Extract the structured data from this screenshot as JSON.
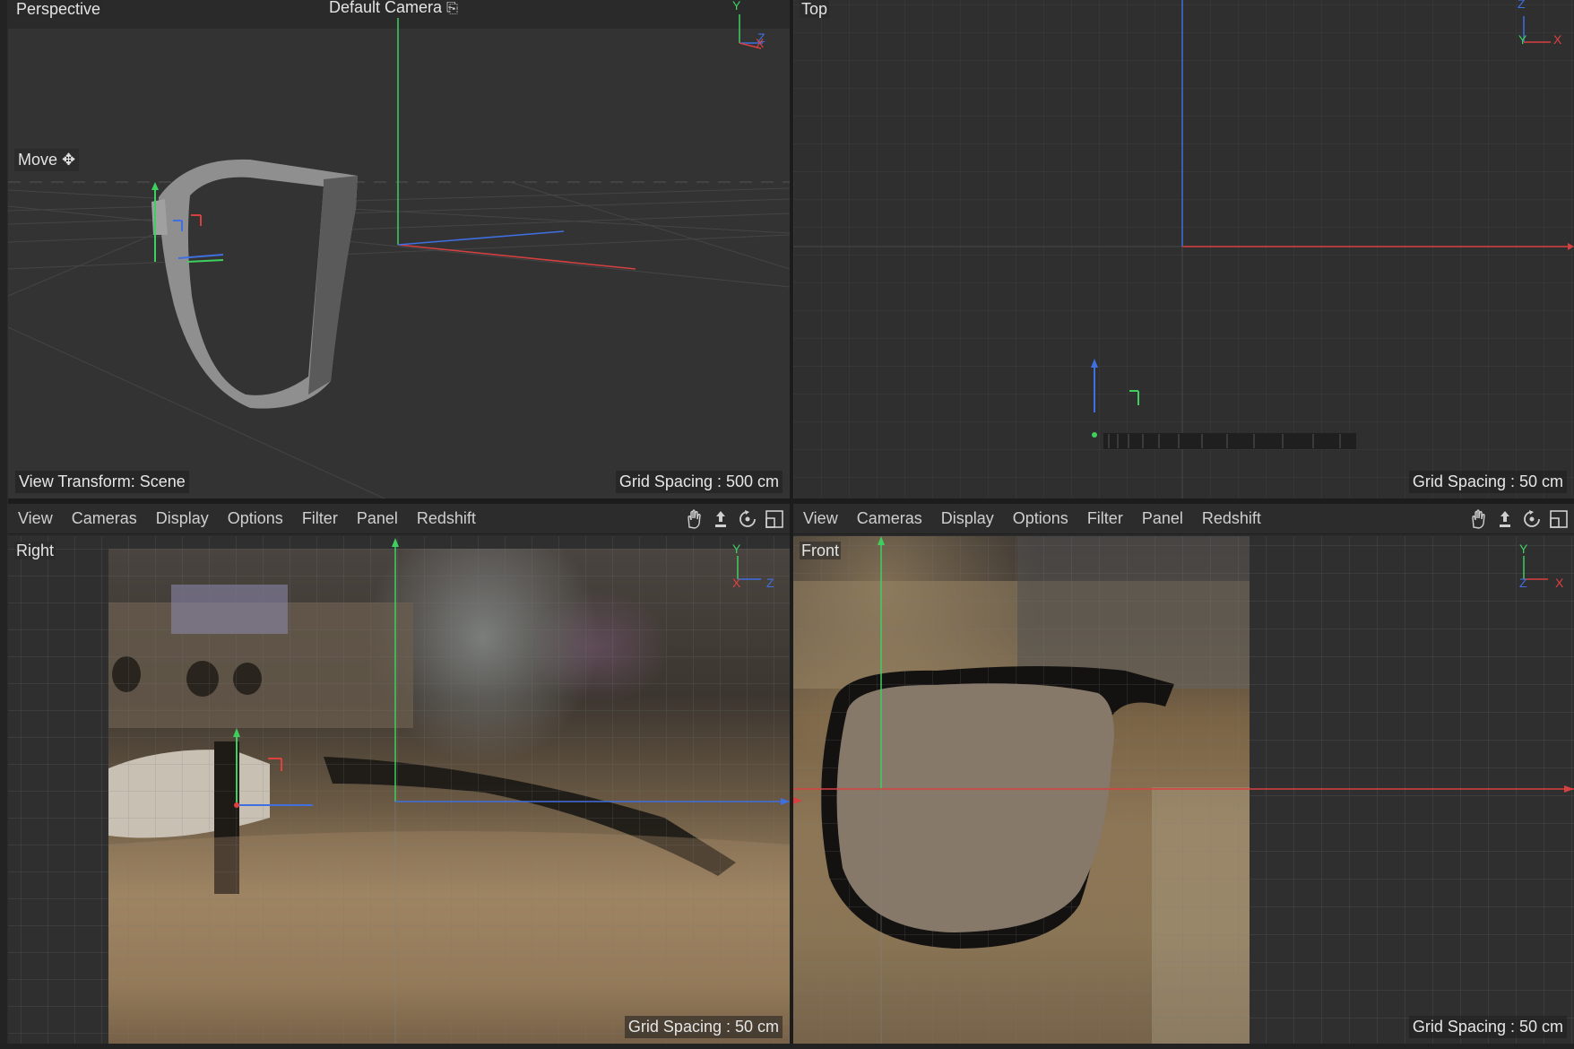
{
  "colors": {
    "x_axis": "#e04040",
    "y_axis": "#40d060",
    "z_axis": "#3f6fe0",
    "grid_line": "#3d3d3e",
    "viewport_bg": "#2f2f30"
  },
  "perspective": {
    "label": "Perspective",
    "camera": "Default Camera",
    "tool": "Move",
    "view_transform": "View Transform: Scene",
    "grid_spacing": "Grid Spacing : 500 cm",
    "axis_labels": {
      "y": "Y",
      "z": "Z",
      "x": "X"
    }
  },
  "top": {
    "label": "Top",
    "grid_spacing": "Grid Spacing : 50 cm",
    "axis_labels": {
      "z": "Z",
      "x": "X",
      "y": "Y"
    }
  },
  "right": {
    "label": "Right",
    "grid_spacing": "Grid Spacing : 50 cm",
    "axis_labels": {
      "y": "Y",
      "x": "X",
      "z": "Z"
    }
  },
  "front": {
    "label": "Front",
    "grid_spacing": "Grid Spacing : 50 cm",
    "axis_labels": {
      "y": "Y",
      "z": "Z",
      "x": "X"
    }
  },
  "menu_left": [
    "View",
    "Cameras",
    "Display",
    "Options",
    "Filter",
    "Panel",
    "Redshift"
  ],
  "menu_right": [
    "View",
    "Cameras",
    "Display",
    "Options",
    "Filter",
    "Panel",
    "Redshift"
  ],
  "toolbar_icons": [
    "pan-hand-icon",
    "move-vertical-icon",
    "rotate-icon",
    "maximize-view-icon"
  ]
}
